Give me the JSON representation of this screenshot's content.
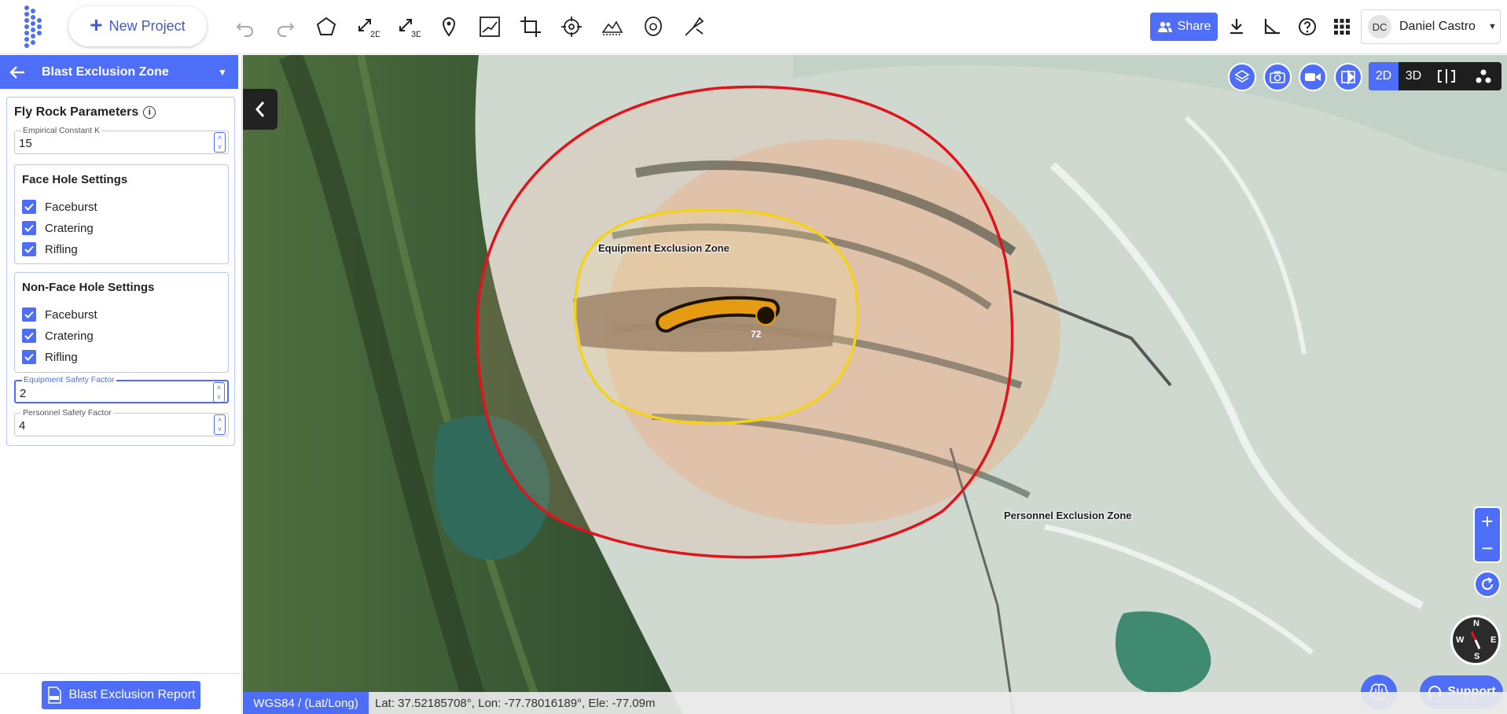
{
  "topbar": {
    "new_project_label": "New Project",
    "share_label": "Share",
    "user_initials": "DC",
    "user_name": "Daniel Castro"
  },
  "panel": {
    "title": "Blast Exclusion Zone",
    "params_title": "Fly Rock Parameters",
    "empirical_k": {
      "label": "Empirical Constant K",
      "value": "15"
    },
    "face_hole": {
      "title": "Face Hole Settings",
      "options": [
        {
          "label": "Faceburst",
          "checked": true
        },
        {
          "label": "Cratering",
          "checked": true
        },
        {
          "label": "Rifling",
          "checked": true
        }
      ]
    },
    "non_face_hole": {
      "title": "Non-Face Hole Settings",
      "options": [
        {
          "label": "Faceburst",
          "checked": true
        },
        {
          "label": "Cratering",
          "checked": true
        },
        {
          "label": "Rifling",
          "checked": true
        }
      ]
    },
    "equipment_safety": {
      "label": "Equipment Safety Factor",
      "value": "2"
    },
    "personnel_safety": {
      "label": "Personnel Safety Factor",
      "value": "4"
    },
    "report_button": "Blast Exclusion Report"
  },
  "map": {
    "view_modes": [
      "2D",
      "3D"
    ],
    "active_view": "2D",
    "equipment_zone_label": "Equipment Exclusion Zone",
    "personnel_zone_label": "Personnel Exclusion Zone",
    "hole_count_badge": "72",
    "zone_colors": {
      "personnel": "#e0141c",
      "equipment": "#f2d21b"
    },
    "accent": "#4f6ef7",
    "compass": {
      "n": "N",
      "s": "S",
      "e": "E",
      "w": "W"
    },
    "support_label": "Support"
  },
  "status": {
    "crs": "WGS84 / (Lat/Long)",
    "coords": "Lat: 37.52185708°, Lon: -77.78016189°, Ele: -77.09m"
  }
}
